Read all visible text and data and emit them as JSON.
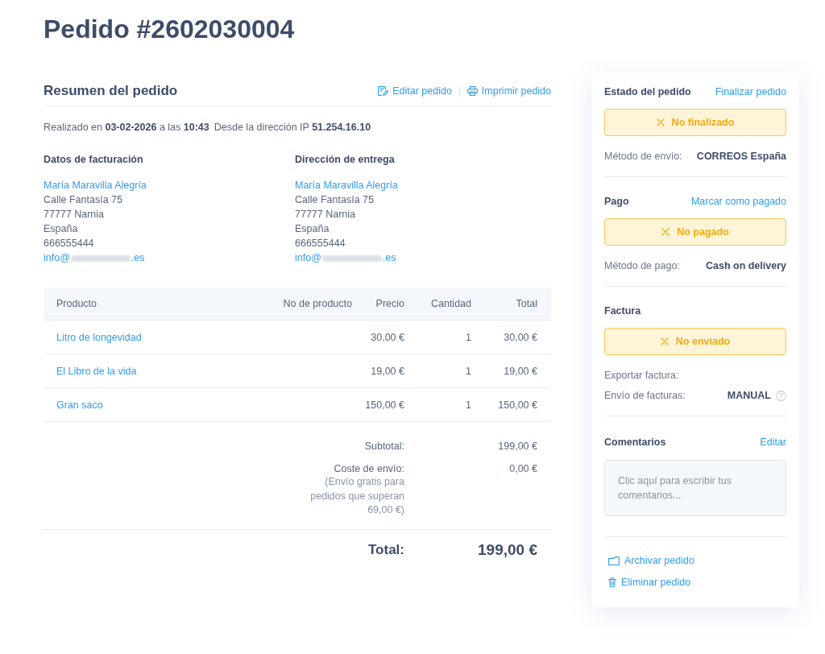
{
  "page": {
    "title": "Pedido #2602030004"
  },
  "summary": {
    "title": "Resumen del pedido",
    "actions": [
      {
        "label": "Editar pedido",
        "kind": "edit"
      },
      {
        "label": "Imprimir pedido",
        "kind": "print"
      }
    ],
    "placed": "Realizado en **03-02-2026** a las **10:43**",
    "ip": "Desde la dirección IP **51.254.16.10**",
    "addresses": [
      {
        "heading": "Datos de facturación",
        "name": "María Maravilla Alegría",
        "lines": [
          "Calle Fantasía 75",
          "77777 Narnia",
          "España",
          "666555444"
        ],
        "email": {
          "start": "info@",
          "end": ".es",
          "redacted": true
        }
      },
      {
        "heading": "Dirección de entrega",
        "name": "María Maravilla Alegría",
        "lines": [
          "Calle Fantasía 75",
          "77777 Narnia",
          "España",
          "666555444"
        ],
        "email": {
          "start": "info@",
          "end": ".es",
          "redacted": true
        }
      }
    ]
  },
  "table": {
    "columns": [
      "Producto",
      "No de producto",
      "Precio",
      "Cantidad",
      "Total"
    ],
    "rows": [
      {
        "product": "Litro de longevidad",
        "price": "30,00 €",
        "quantity": "1",
        "total": "30,00 €"
      },
      {
        "product": "El Libro de la vida",
        "price": "19,00 €",
        "quantity": "1",
        "total": "19,00 €"
      },
      {
        "product": "Gran saco",
        "price": "150,00 €",
        "quantity": "1",
        "total": "150,00 €"
      }
    ]
  },
  "totals": {
    "subtotal": {
      "label": "Subtotal:",
      "value": "199,00 €"
    },
    "shipping": {
      "label": "Coste de envío:",
      "note": "(Envío gratis para pedidos que superan 69,00 €)",
      "value": "0,00 €"
    },
    "total": {
      "label": "Total:",
      "value": "199,00 €"
    }
  },
  "sidebar": {
    "sections": [
      {
        "title": "Estado del pedido",
        "action": "Finalizar pedido",
        "status": {
          "label": "No finalizado",
          "done": false
        },
        "fields": [
          {
            "label": "Método de envío:",
            "value": "CORREOS España"
          }
        ]
      },
      {
        "title": "Pago",
        "action": "Marcar como pagado",
        "status": {
          "label": "No pagado",
          "done": false
        },
        "fields": [
          {
            "label": "Método de pago:",
            "value": "Cash on delivery"
          }
        ]
      },
      {
        "title": "Factura",
        "status": {
          "label": "No enviado",
          "done": false
        },
        "fields": [
          {
            "label": "Exportar factura:"
          },
          {
            "label": "Envío de facturas:",
            "value": "MANUAL",
            "help": true
          }
        ]
      },
      {
        "title": "Comentarios",
        "action": "Editar",
        "comment": {
          "placeholder": "Clic aquí para escribir tus comentarios..."
        }
      }
    ],
    "footer_actions": [
      {
        "label": "Archivar pedido",
        "kind": "archive"
      },
      {
        "label": "Eliminar pedido",
        "kind": "delete"
      }
    ]
  }
}
